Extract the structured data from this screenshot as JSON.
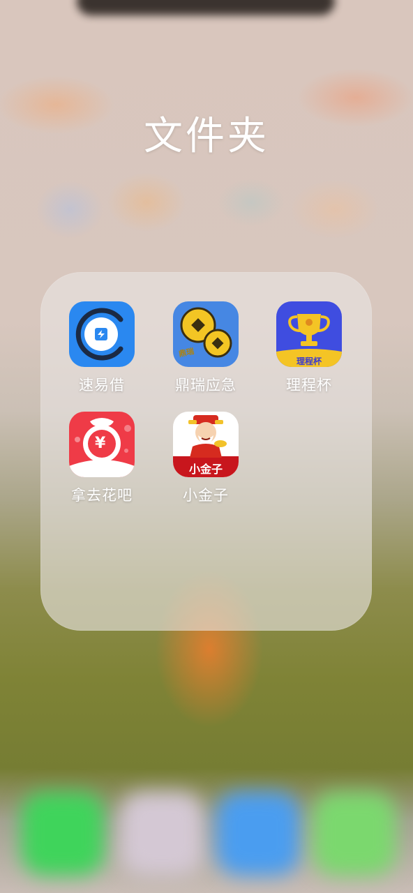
{
  "folder": {
    "title": "文件夹"
  },
  "apps": [
    {
      "name": "速易借",
      "icon": "suyijie-app-icon",
      "color": "#2a88f0"
    },
    {
      "name": "鼎瑞应急",
      "icon": "dingrui-coins-icon",
      "color": "#4687e3",
      "icon_text": "鼎瑞"
    },
    {
      "name": "理程杯",
      "icon": "trophy-icon",
      "color": "#3f4de0",
      "icon_text": "理程杯"
    },
    {
      "name": "拿去花吧",
      "icon": "money-bag-icon",
      "color": "#ef3b47",
      "icon_text": "¥"
    },
    {
      "name": "小金子",
      "icon": "god-of-wealth-icon",
      "color": "#c8161d",
      "icon_text": "小金子"
    }
  ]
}
